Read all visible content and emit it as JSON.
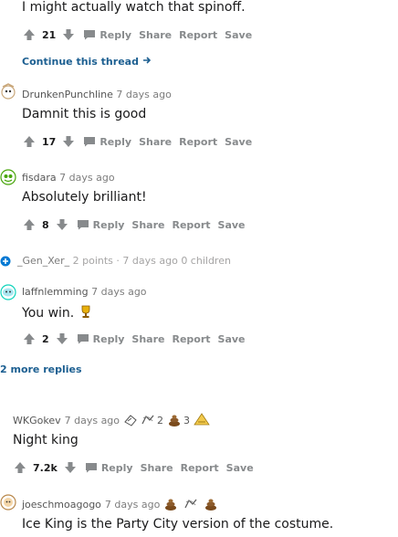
{
  "comments": [
    {
      "text": "I might actually watch that spinoff.",
      "score": "21"
    },
    {
      "user": "DrunkenPunchline",
      "time": "7 days ago",
      "text": "Damnit this is good",
      "score": "17"
    },
    {
      "user": "fisdara",
      "time": "7 days ago",
      "text": "Absolutely brilliant!",
      "score": "8"
    },
    {
      "user": "laffnlemming",
      "time": "7 days ago",
      "text": "You win.",
      "score": "2"
    },
    {
      "user": "WKGokev",
      "time": "7 days ago",
      "text": "Night king",
      "score": "7.2k",
      "award1_count": "2",
      "award2_count": "3"
    },
    {
      "user": "joeschmoagogo",
      "time": "7 days ago",
      "text": "Ice King is the Party City version of the costume."
    }
  ],
  "actions": {
    "reply": "Reply",
    "share": "Share",
    "report": "Report",
    "save": "Save"
  },
  "continue_thread": "Continue this thread",
  "collapsed": {
    "user": "_Gen_Xer_",
    "points": "2 points",
    "dot": "·",
    "time": "7 days ago",
    "children": "0 children"
  },
  "more_replies": "2 more replies",
  "colors": {
    "link": "#1c5f91",
    "muted": "#878a8c",
    "text": "#1a1a1b"
  }
}
